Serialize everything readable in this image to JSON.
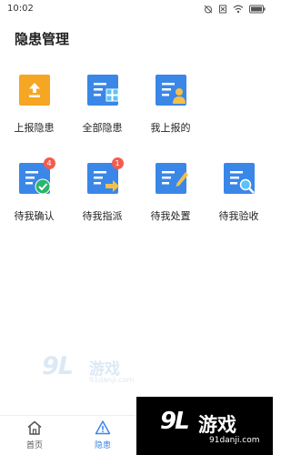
{
  "status_bar": {
    "time": "10:02"
  },
  "page": {
    "title": "隐患管理"
  },
  "grid": {
    "items": [
      {
        "label": "上报隐患",
        "icon": "upload-icon"
      },
      {
        "label": "全部隐患",
        "icon": "all-hazards-icon"
      },
      {
        "label": "我上报的",
        "icon": "my-reports-icon"
      },
      {
        "label": "待我确认",
        "icon": "confirm-icon",
        "badge": "4"
      },
      {
        "label": "待我指派",
        "icon": "assign-icon",
        "badge": "1"
      },
      {
        "label": "待我处置",
        "icon": "handle-icon"
      },
      {
        "label": "待我验收",
        "icon": "inspect-icon"
      }
    ]
  },
  "tabs": [
    {
      "label": "首页",
      "icon": "home-icon",
      "active": false
    },
    {
      "label": "隐患",
      "icon": "warning-icon",
      "active": true
    }
  ],
  "watermark": {
    "number": "9L",
    "name": "游戏",
    "url": "91danji.com"
  },
  "corner_logo": {
    "number": "9L",
    "name": "游戏",
    "url": "91danji.com"
  },
  "colors": {
    "accent": "#3a87e8",
    "orange": "#f5a623",
    "badge": "#f25c4e",
    "green": "#2ab56b"
  }
}
